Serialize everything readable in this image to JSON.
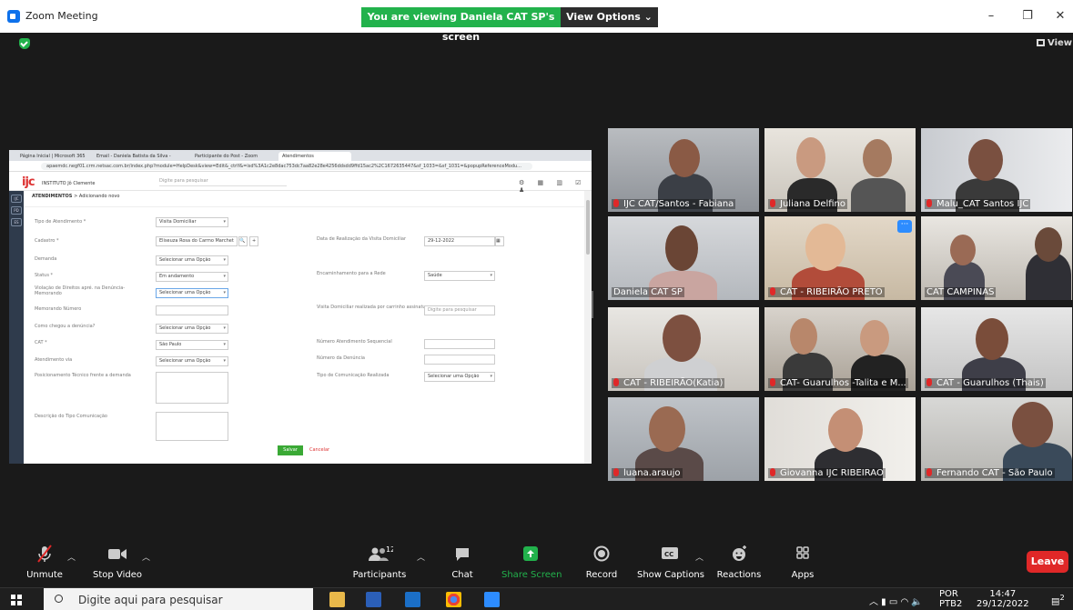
{
  "window": {
    "title": "Zoom Meeting",
    "viewing_banner": "You are viewing Daniela CAT SP's screen",
    "view_options": "View Options ⌄"
  },
  "view_button": "View",
  "browser": {
    "tabs": [
      "Página Inicial | Microsoft 365",
      "Email - Daniela Batista da Silva -",
      "Participante do Post - Zoom",
      "Atendimentos"
    ],
    "url": "apaemdc.negf01.crm.netsac.com.br/index.php?module=HelpDesk&view=Edit&_ctrlf&=isd%3A1c2e8dac753dc7aa82e28e4256ddsdd9ffd15ac2%2C1672635447&sf_1033=&sf_1031=&popupReferenceModu..."
  },
  "app": {
    "logo_main": "ijc",
    "logo_sub": "INSTITUTO Jô Clemente",
    "search_placeholder": "Digite para pesquisar",
    "breadcrumb_section": "ATENDIMENTOS",
    "breadcrumb_sub": "> Adicionando novo",
    "sidebar": [
      "IJC",
      "PD",
      "ES"
    ]
  },
  "form": {
    "tipo_label": "Tipo de Atendimento *",
    "tipo_value": "Visita Domiciliar",
    "cadastro_label": "Cadastro *",
    "cadastro_value": "Eliseuza Rosa do Carmo Marchet",
    "data_label": "Data de Realização da Visita Domiciliar",
    "data_value": "29-12-2022",
    "demanda_label": "Demanda",
    "demanda_value": "Selecionar uma Opção",
    "status_label": "Status *",
    "status_value": "Em andamento",
    "encaminhamento_label": "Encaminhamento para a Rede",
    "encaminhamento_value": "Saúde",
    "violacao_label": "Violação de Direitos apré. na Denúncia-Memorando",
    "violacao_value": "Selecionar uma Opção",
    "memorando_label": "Memorando Número",
    "visita_label": "Visita Domiciliar realizada por carrinho assinatura",
    "visita_value": "Digite para pesquisar",
    "como_label": "Como chegou a denúncia?",
    "como_value": "Selecionar uma Opção",
    "cat_label": "CAT *",
    "cat_value": "São Paulo",
    "num_atend_label": "Número Atendimento Sequencial",
    "atend_via_label": "Atendimento via",
    "atend_via_value": "Selecionar uma Opção",
    "num_denuncia_label": "Número da Denúncia",
    "posicionamento_label": "Posicionamento Técnico frente a demanda",
    "tipo_com_label": "Tipo de Comunicação Realizada",
    "tipo_com_value": "Selecionar uma Opção",
    "descricao_label": "Descrição do Tipo Comunicação",
    "save": "Salvar",
    "cancel": "Cancelar"
  },
  "participants": [
    {
      "name": "IJC CAT/Santos - Fabiana",
      "muted": true
    },
    {
      "name": "Juliana Delfino",
      "muted": true
    },
    {
      "name": "Malu_CAT Santos IJC",
      "muted": true
    },
    {
      "name": "Daniela CAT SP",
      "muted": false
    },
    {
      "name": "CAT - RIBEIRÃO PRETO",
      "muted": true
    },
    {
      "name": "CAT CAMPINAS",
      "muted": false
    },
    {
      "name": "CAT - RIBEIRÃO(Katia)",
      "muted": true
    },
    {
      "name": "CAT- Guarulhos -Talita e M...",
      "muted": true
    },
    {
      "name": "CAT - Guarulhos (Thais)",
      "muted": true
    },
    {
      "name": "luana.araujo",
      "muted": true
    },
    {
      "name": "Giovanna IJC RIBEIRAO",
      "muted": true
    },
    {
      "name": "Fernando CAT - São Paulo",
      "muted": true
    }
  ],
  "toolbar": {
    "unmute": "Unmute",
    "stop_video": "Stop Video",
    "participants": "Participants",
    "participants_count": "12",
    "chat": "Chat",
    "share_screen": "Share Screen",
    "record": "Record",
    "captions": "Show Captions",
    "reactions": "Reactions",
    "apps": "Apps",
    "leave": "Leave",
    "cc": "CC"
  },
  "taskbar": {
    "search_placeholder": "Digite aqui para pesquisar",
    "lang": "POR",
    "layout": "PTB2",
    "time": "14:47",
    "date": "29/12/2022",
    "notif": "2"
  },
  "colors": {
    "zoom_green": "#22b24c",
    "leave_red": "#e02828",
    "active_speaker": "#d8d85a",
    "zoom_blue": "#2d8cff"
  }
}
